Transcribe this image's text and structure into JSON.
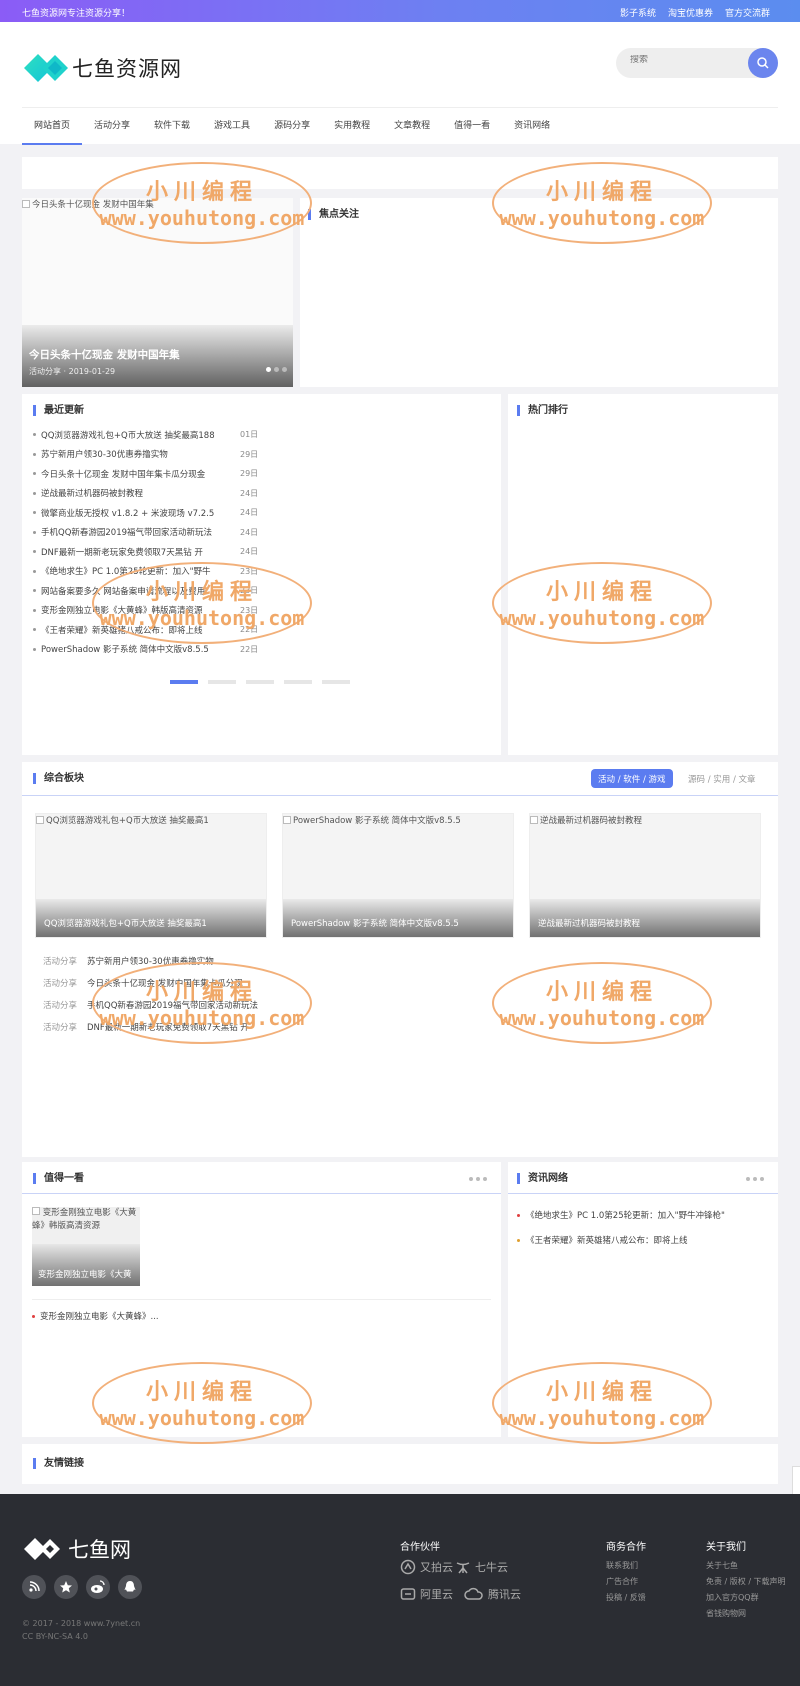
{
  "topbar": {
    "notice": "七鱼资源网专注资源分享！",
    "links": [
      "影子系统",
      "淘宝优惠券",
      "官方交流群"
    ]
  },
  "header": {
    "logo_text": "七鱼资源网",
    "search_placeholder": "搜索",
    "nav": [
      "网站首页",
      "活动分享",
      "软件下载",
      "游戏工具",
      "源码分享",
      "实用教程",
      "文章教程",
      "值得一看",
      "资讯网络"
    ]
  },
  "slider": {
    "image_alt": "今日头条十亿现金 发财中国年集",
    "caption_title": "今日头条十亿现金 发财中国年集",
    "caption_meta": "活动分享 · 2019-01-29"
  },
  "focus": {
    "title": "焦点关注"
  },
  "recent": {
    "title": "最近更新",
    "items": [
      {
        "title": "QQ浏览器游戏礼包+Q币大放送 抽奖最高188",
        "date": "01日"
      },
      {
        "title": "苏宁新用户领30-30优惠券撸实物",
        "date": "29日"
      },
      {
        "title": "今日头条十亿现金 发财中国年集卡瓜分现金",
        "date": "29日"
      },
      {
        "title": "逆战最新过机器码被封教程",
        "date": "24日"
      },
      {
        "title": "微擎商业版无授权 v1.8.2 + 米波现场 v7.2.5",
        "date": "24日"
      },
      {
        "title": "手机QQ新春游园2019福气带回家活动新玩法",
        "date": "24日"
      },
      {
        "title": "DNF最新一期新老玩家免费领取7天黑钻 开",
        "date": "24日"
      },
      {
        "title": "《绝地求生》PC 1.0第25轮更新：加入\"野牛",
        "date": "23日"
      },
      {
        "title": "网站备案要多久 网站备案申请流程以及费用",
        "date": "23日"
      },
      {
        "title": "变形金刚独立电影《大黄蜂》韩版高清资源",
        "date": "23日"
      },
      {
        "title": "《王者荣耀》新英雄猪八戒公布：即将上线",
        "date": "22日"
      },
      {
        "title": "PowerShadow 影子系统 简体中文版v8.5.5",
        "date": "22日"
      }
    ]
  },
  "hot": {
    "title": "热门排行"
  },
  "combined": {
    "title": "综合板块",
    "tab_active": "活动 / 软件 / 游戏",
    "tab_inactive": "源码 / 实用 / 文章",
    "cards": [
      {
        "alt": "QQ浏览器游戏礼包+Q币大放送 抽奖最高1",
        "caption": "QQ浏览器游戏礼包+Q币大放送 抽奖最高1"
      },
      {
        "alt": "PowerShadow 影子系统 简体中文版v8.5.5",
        "caption": "PowerShadow 影子系统 简体中文版v8.5.5"
      },
      {
        "alt": "逆战最新过机器码被封教程",
        "caption": "逆战最新过机器码被封教程"
      }
    ],
    "list": [
      {
        "cat": "活动分享",
        "title": "苏宁新用户领30-30优惠券撸实物"
      },
      {
        "cat": "活动分享",
        "title": "今日头条十亿现金 发财中国年集卡瓜分现"
      },
      {
        "cat": "活动分享",
        "title": "手机QQ新春游园2019福气带回家活动新玩法"
      },
      {
        "cat": "活动分享",
        "title": "DNF最新一期新老玩家免费领取7天黑钻 开"
      }
    ]
  },
  "worth": {
    "title": "值得一看",
    "card_alt": "变形金刚独立电影《大黄蜂》韩版高清资源",
    "card_caption": "变形金刚独立电影《大黄",
    "item": "变形金刚独立电影《大黄蜂》..."
  },
  "news": {
    "title": "资讯网络",
    "items": [
      "《绝地求生》PC 1.0第25轮更新：加入\"野牛冲锋枪\"",
      "《王者荣耀》新英雄猪八戒公布：即将上线"
    ]
  },
  "friends": {
    "title": "友情链接"
  },
  "footer": {
    "logo_text": "七鱼网",
    "copyright": "© 2017 - 2018 www.7ynet.cn",
    "license": "CC BY-NC-SA 4.0",
    "partners_title": "合作伙伴",
    "partners": [
      "又拍云",
      "七牛云",
      "阿里云",
      "腾讯云"
    ],
    "business_title": "商务合作",
    "business_links": [
      "联系我们",
      "广告合作",
      "投稿 / 反馈"
    ],
    "about_title": "关于我们",
    "about_links": [
      "关于七鱼",
      "免责 / 版权 / 下载声明",
      "加入官方QQ群",
      "省钱购物网"
    ]
  },
  "watermark": {
    "line1": "小川编程",
    "line2": "www.youhutong.com"
  },
  "colors": {
    "accent": "#5b7cf0",
    "footer_bg": "#2b2d33",
    "topbar_start": "#8b5cf6",
    "topbar_end": "#5b8def",
    "watermark": "#f0a868"
  }
}
